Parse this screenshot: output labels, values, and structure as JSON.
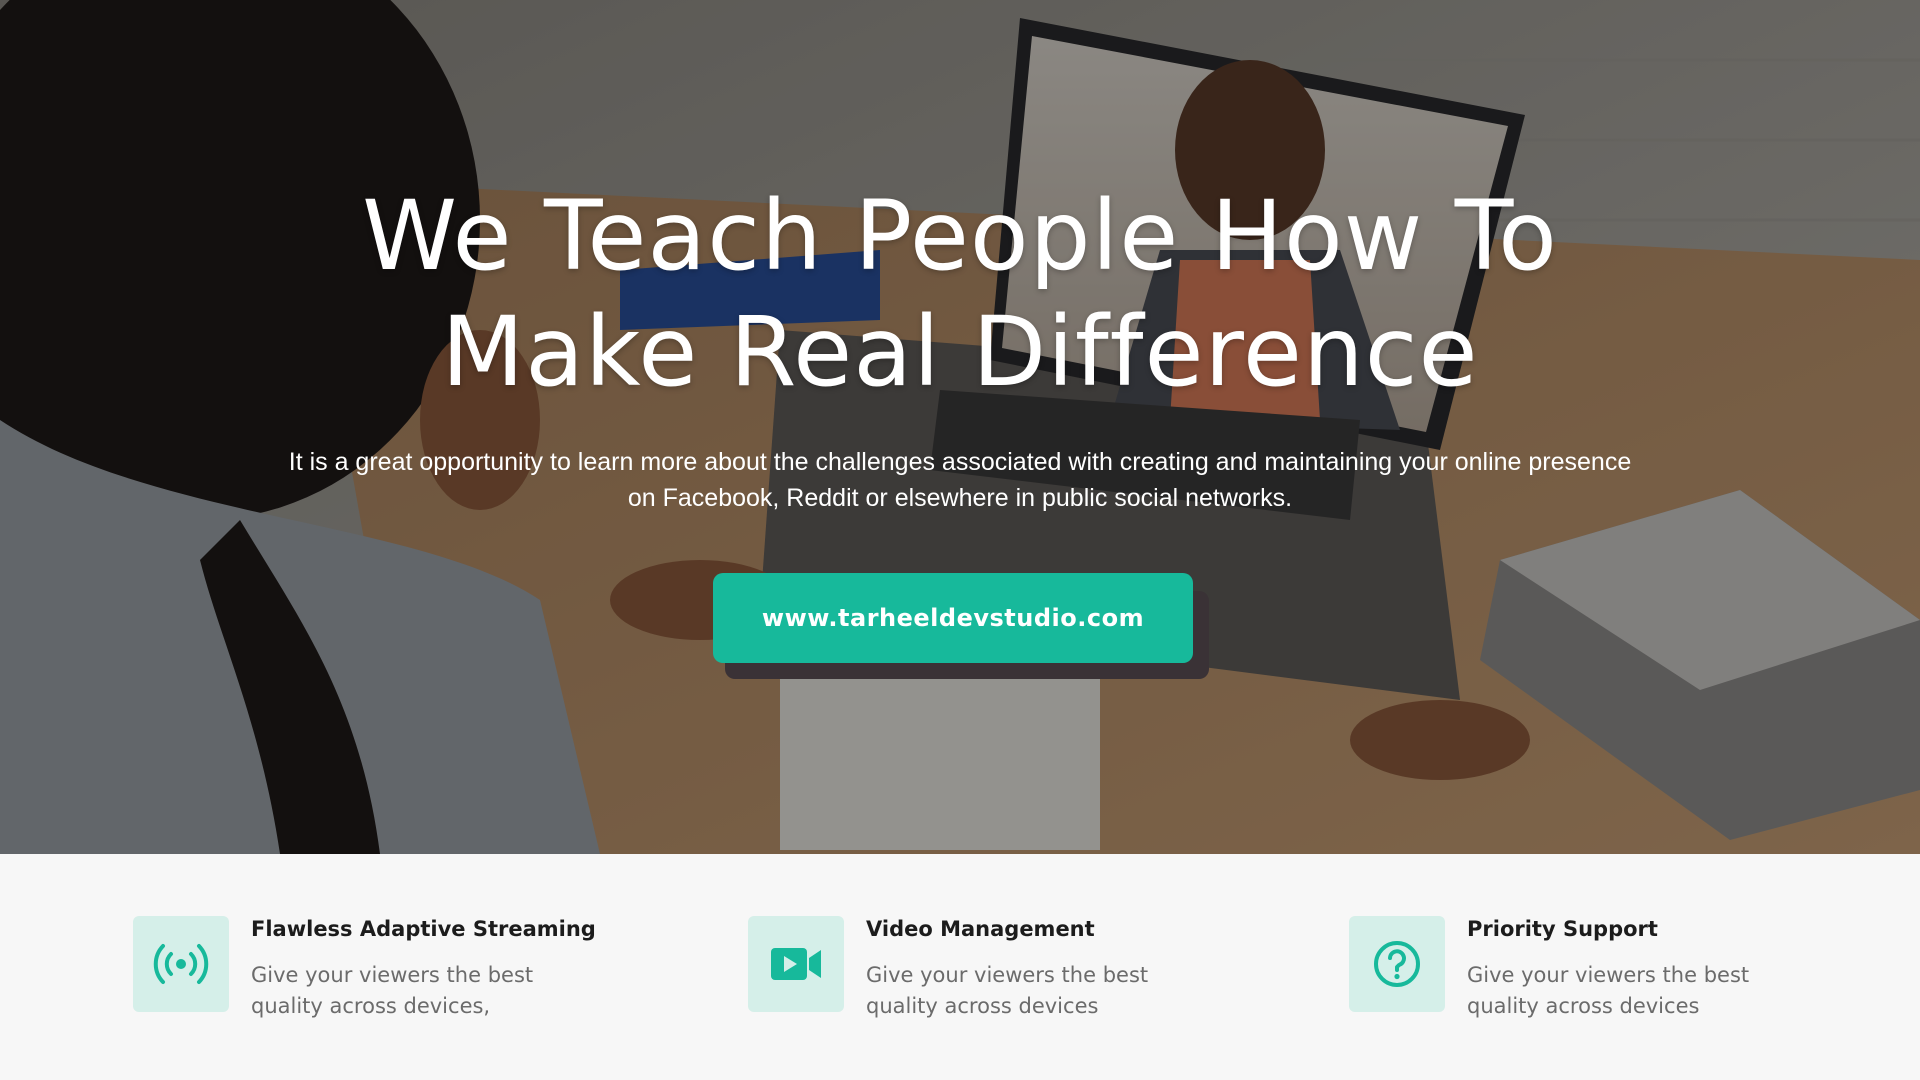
{
  "colors": {
    "accent": "#17b99b",
    "icon_bg": "#d5efe9",
    "heading": "#1c1c1c",
    "body_text": "#6b6b6b"
  },
  "hero": {
    "title_line1": "We Teach People How To",
    "title_line2": "Make Real Difference",
    "subtitle": "It is a great opportunity to learn more about the challenges associated with creating and maintaining your online presence on Facebook, Reddit or elsewhere in public social networks.",
    "cta_label": "www.tarheeldevstudio.com"
  },
  "features": [
    {
      "icon": "broadcast-icon",
      "title": "Flawless Adaptive Streaming",
      "description": "Give your viewers the best quality across devices,"
    },
    {
      "icon": "video-camera-icon",
      "title": "Video Management",
      "description": "Give your viewers the best quality across devices"
    },
    {
      "icon": "question-icon",
      "title": "Priority Support",
      "description": "Give your viewers the best quality across devices"
    }
  ]
}
